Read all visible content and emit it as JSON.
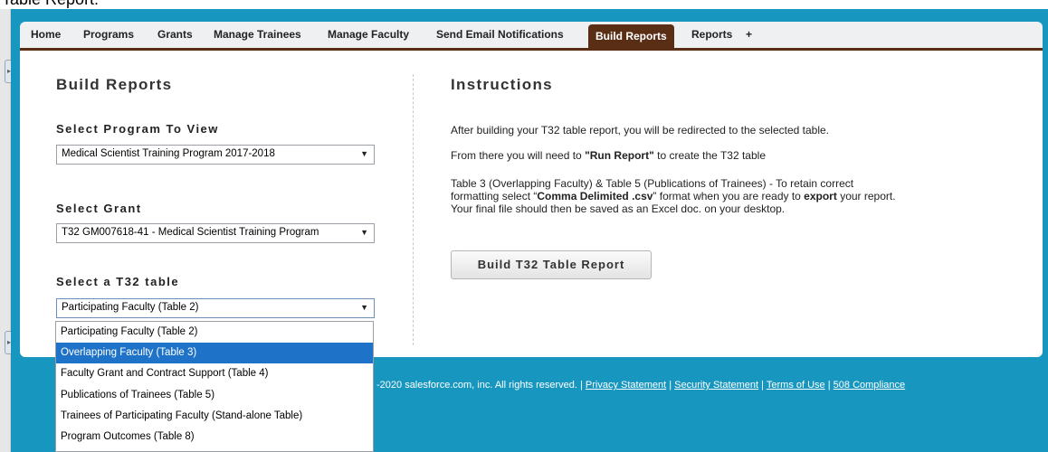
{
  "header_text": "Table Report:",
  "nav": {
    "items": [
      {
        "label": "Home"
      },
      {
        "label": "Programs"
      },
      {
        "label": "Grants"
      },
      {
        "label": "Manage Trainees"
      },
      {
        "label": "Manage Faculty"
      },
      {
        "label": "Send Email Notifications"
      },
      {
        "label": "Build Reports",
        "active": true
      },
      {
        "label": "Reports"
      },
      {
        "label": "+"
      }
    ]
  },
  "left": {
    "title": "Build Reports",
    "program": {
      "label": "Select Program To View",
      "value": "Medical Scientist Training Program 2017-2018"
    },
    "grant": {
      "label": "Select Grant",
      "value": "T32 GM007618-41 - Medical Scientist Training Program"
    },
    "table": {
      "label": "Select a T32 table",
      "value": "Participating Faculty (Table 2)"
    }
  },
  "instructions": {
    "title": "Instructions",
    "p1": "After building your T32 table report, you will be redirected to the selected table.",
    "p2_pre": "From there you will need to ",
    "p2_bold": "\"Run Report\"",
    "p2_post": " to create the T32 table",
    "p3_a": "Table 3 (Overlapping Faculty) & Table 5 (Publications of Trainees) - To retain correct",
    "p3_b": "formatting select “",
    "p3_c": "Comma Delimited .csv",
    "p3_d": "” format when you are ready to ",
    "p3_e": "export",
    "p3_f": " your report.",
    "p3_g": "Your final file should then be saved as an Excel doc. on your desktop.",
    "button": "Build T32 Table Report"
  },
  "footer": {
    "copyright": "-2020 salesforce.com, inc. All rights reserved. | ",
    "links": [
      "Privacy Statement",
      "Security Statement",
      "Terms of Use",
      "508 Compliance"
    ],
    "sep": " | "
  },
  "dropdown": {
    "options": [
      "Participating Faculty (Table 2)",
      "Overlapping Faculty (Table 3)",
      "Faculty Grant and Contract Support (Table 4)",
      "Publications of Trainees (Table 5)",
      "Trainees of Participating Faculty (Stand-alone Table)",
      "Program Outcomes (Table 8)"
    ],
    "highlighted": "Overlapping Faculty (Table 3)"
  },
  "icons": {
    "dropdown_arrow": "chevron-down-icon",
    "side_handle": "expand-handle-icon"
  },
  "colors": {
    "page_bg": "#1797c0",
    "active_tab": "#5a2e15",
    "highlight": "#1e73c8"
  }
}
